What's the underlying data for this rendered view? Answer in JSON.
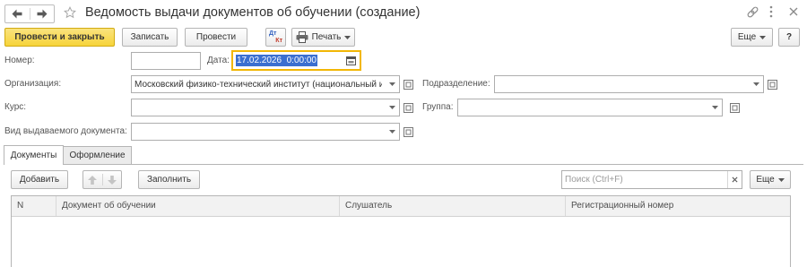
{
  "window": {
    "title": "Ведомость выдачи документов об обучении (создание)",
    "icons": {
      "back": "arrow-left-icon",
      "forward": "arrow-right-icon",
      "favorite": "star-icon",
      "link": "link-icon",
      "more": "more-vertical-icon",
      "close": "close-icon"
    }
  },
  "toolbar": {
    "post_and_close_label": "Провести и закрыть",
    "save_label": "Записать",
    "post_label": "Провести",
    "dt_kt": {
      "dt": "Дт",
      "kt": "Кт",
      "icon": "dt-kt-icon"
    },
    "print_label": "Печать",
    "print_icon": "printer-icon",
    "more_label": "Еще",
    "help_label": "?"
  },
  "fields": {
    "number": {
      "label": "Номер:",
      "value": ""
    },
    "date": {
      "label": "Дата:",
      "value": "17.02.2026  0:00:00",
      "focused": true,
      "text_selected": true,
      "icon": "calendar-icon"
    },
    "organization": {
      "label": "Организация:",
      "value": "Московский физико-технический институт (национальный ис"
    },
    "department": {
      "label": "Подразделение:",
      "value": ""
    },
    "course": {
      "label": "Курс:",
      "value": ""
    },
    "group": {
      "label": "Группа:",
      "value": ""
    },
    "document_type": {
      "label": "Вид выдаваемого документа:",
      "value": ""
    }
  },
  "tabs": {
    "items": [
      "Документы",
      "Оформление"
    ],
    "active": 0
  },
  "table_toolbar": {
    "add_label": "Добавить",
    "move_up_disabled": true,
    "move_down_disabled": true,
    "fill_label": "Заполнить",
    "search_placeholder": "Поиск (Ctrl+F)",
    "search_value": "",
    "more_label": "Еще"
  },
  "table": {
    "columns": [
      "N",
      "Документ об обучении",
      "Слушатель",
      "Регистрационный номер"
    ],
    "rows": []
  },
  "colors": {
    "primary_button": "#f7d43a",
    "focus_border": "#f2b705",
    "selection": "#3b6fd0"
  }
}
